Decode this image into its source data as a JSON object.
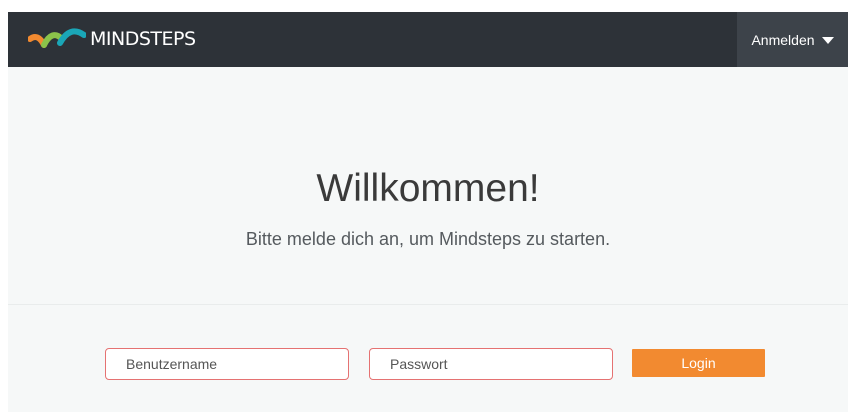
{
  "navbar": {
    "brand_text": "MINDSTEPS",
    "logo_icon": "mindsteps-arcs-logo",
    "login_menu_label": "Anmelden",
    "login_menu_icon": "caret-down-icon"
  },
  "hero": {
    "title": "Willkommen!",
    "subtitle": "Bitte melde dich an, um Mindsteps zu starten."
  },
  "login_form": {
    "username_placeholder": "Benutzername",
    "username_value": "",
    "password_placeholder": "Passwort",
    "password_value": "",
    "submit_label": "Login"
  },
  "colors": {
    "navbar_bg": "#2d3238",
    "menu_bg": "#3d434a",
    "page_bg": "#f6f8f8",
    "field_border": "#e57272",
    "button_bg": "#f28a30",
    "logo_orange": "#f28a30",
    "logo_green": "#8bc34a",
    "logo_teal": "#1aa6b7"
  }
}
